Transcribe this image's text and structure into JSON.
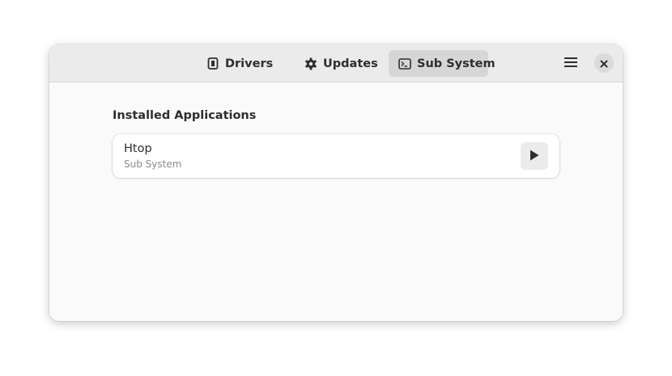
{
  "header": {
    "tabs": [
      {
        "label": "Drivers",
        "icon": "chip-icon",
        "active": false
      },
      {
        "label": "Updates",
        "icon": "gear-icon",
        "active": false
      },
      {
        "label": "Sub System",
        "icon": "terminal-icon",
        "active": true
      }
    ],
    "menu_icon": "hamburger-menu-icon",
    "close_icon": "close-icon"
  },
  "main": {
    "section_title": "Installed Applications",
    "apps": [
      {
        "name": "Htop",
        "subtitle": "Sub System",
        "action_icon": "play-icon"
      }
    ]
  },
  "colors": {
    "headerbar": "#ebebeb",
    "active_tab": "#d6d6d6",
    "content_bg": "#fafafa",
    "card_bg": "#ffffff",
    "text": "#2e2e2e",
    "subtext": "#8a8a8a"
  }
}
